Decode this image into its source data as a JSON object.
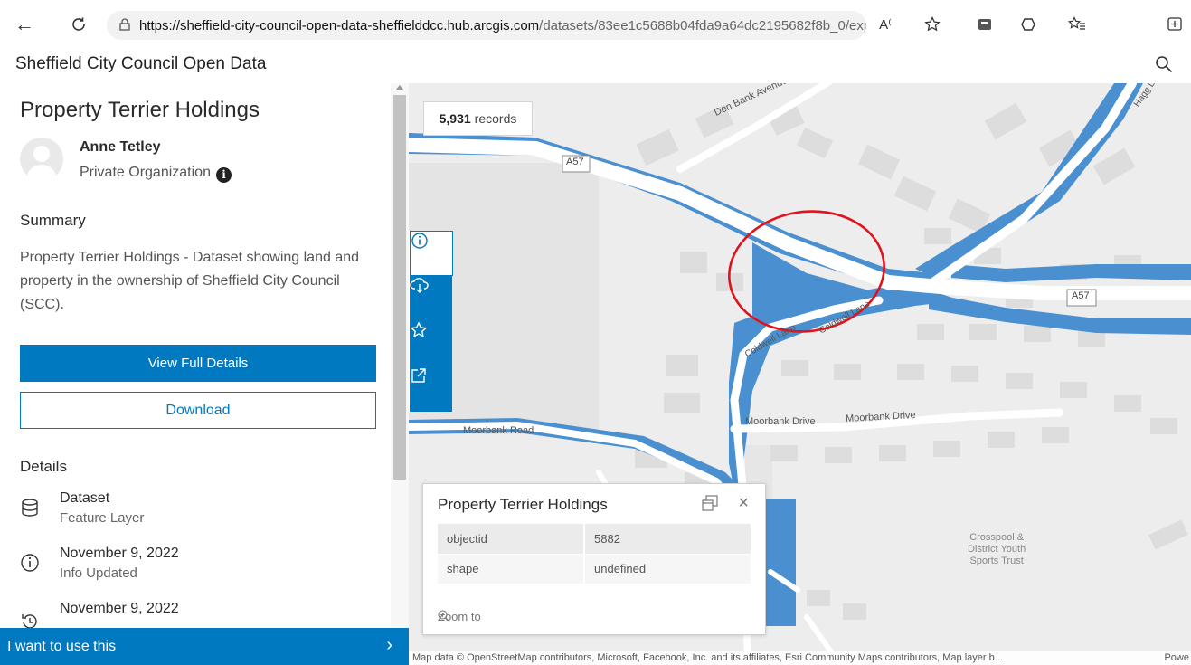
{
  "browser": {
    "url_host": "https://sheffield-city-council-open-data-sheffielddcc.hub.arcgis.com",
    "url_path": "/datasets/83ee1c5688b04fda9a64dc2195682f8b_0/expl..."
  },
  "site": {
    "title": "Sheffield City Council Open Data"
  },
  "dataset": {
    "title": "Property Terrier Holdings",
    "owner_name": "Anne Tetley",
    "owner_type": "Private Organization",
    "summary_heading": "Summary",
    "summary_text": "Property Terrier Holdings - Dataset showing land and property in the ownership of Sheffield City Council (SCC).",
    "view_details_label": "View Full Details",
    "download_label": "Download",
    "details_heading": "Details",
    "details": [
      {
        "main": "Dataset",
        "sub": "Feature Layer",
        "icon": "database-icon"
      },
      {
        "main": "November 9, 2022",
        "sub": "Info Updated",
        "icon": "info-icon"
      },
      {
        "main": "November 9, 2022",
        "sub": "",
        "icon": "history-icon"
      }
    ],
    "use_bar_label": "I want to use this"
  },
  "map": {
    "records_count": "5,931",
    "records_label": "records",
    "labels": {
      "den_bank_avenue": "Den Bank Avenue",
      "a57_left": "A57",
      "a57_right": "A57",
      "coldwell_lane": "Coldwell Lane",
      "coldwell_lane_2": "Coldwell Lane",
      "moorbank_road": "Moorbank Road",
      "moorbank_drive_1": "Moorbank Drive",
      "moorbank_drive_2": "Moorbank Drive",
      "crosspool_1": "Crosspool &",
      "crosspool_2": "District Youth",
      "crosspool_3": "Sports Trust",
      "hagg": "Hagg L"
    },
    "attribution": "Map data © OpenStreetMap contributors, Microsoft, Facebook, Inc. and its affiliates, Esri Community Maps contributors, Map layer b...",
    "powered": "Powe",
    "highlight_color": "#4a90d0",
    "circle_color": "#e0121b"
  },
  "popup": {
    "title": "Property Terrier Holdings",
    "rows": [
      {
        "key": "objectid",
        "value": "5882"
      },
      {
        "key": "shape",
        "value": "undefined"
      }
    ],
    "zoom_label": "Zoom to"
  },
  "colors": {
    "accent": "#0079c1"
  }
}
